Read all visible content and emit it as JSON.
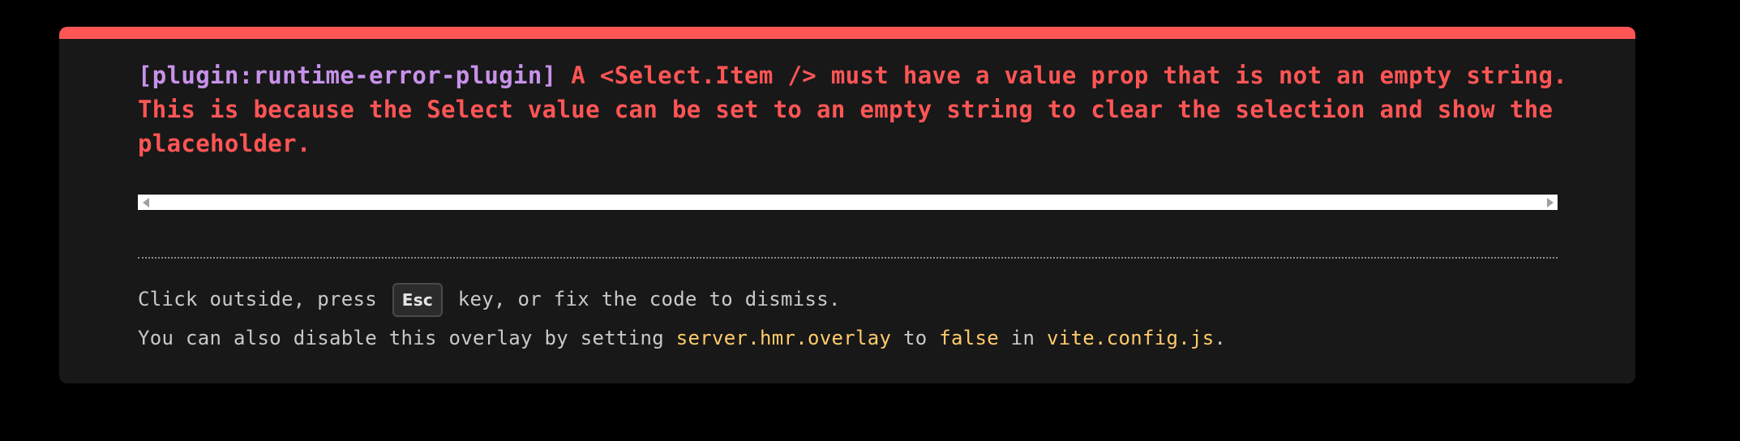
{
  "error": {
    "plugin": "[plugin:runtime-error-plugin]",
    "message": "A <Select.Item /> must have a value prop that is not an empty string. This is because the Select value can be set to an empty string to clear the selection and show the placeholder."
  },
  "tip": {
    "line1_prefix": "Click outside, press ",
    "key_label": "Esc",
    "line1_suffix": " key, or fix the code to dismiss.",
    "line2_part1": "You can also disable this overlay by setting ",
    "line2_code1": "server.hmr.overlay",
    "line2_part2": " to ",
    "line2_code2": "false",
    "line2_part3": " in ",
    "line2_code3": "vite.config.js",
    "line2_part4": "."
  },
  "icons": {
    "scroll_left": "scroll-left-arrow-icon",
    "scroll_right": "scroll-right-arrow-icon"
  },
  "colors": {
    "accent_bar": "#ff5555",
    "error_text": "#ff5555",
    "plugin_text": "#c792ea",
    "code_text": "#ffcb6b",
    "panel_bg": "#181818"
  }
}
